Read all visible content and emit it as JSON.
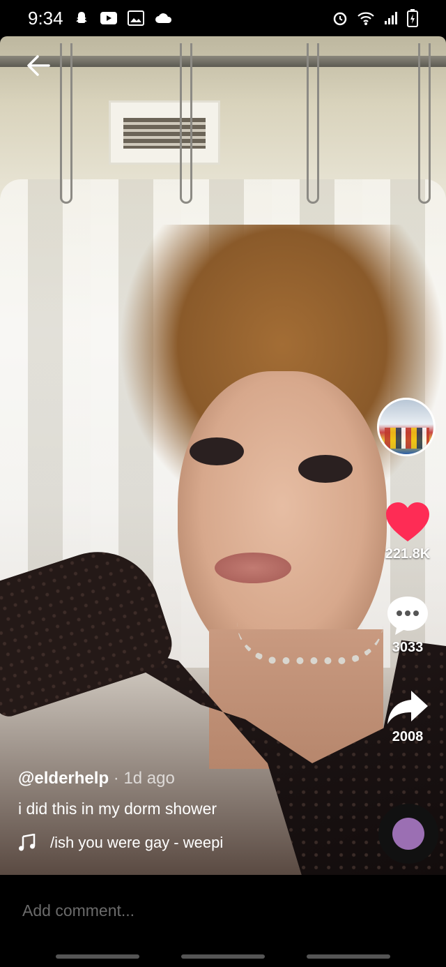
{
  "status_bar": {
    "time": "9:34",
    "left_icons": [
      "snapchat-icon",
      "youtube-icon",
      "gallery-icon",
      "cloud-icon"
    ],
    "right_icons": [
      "alarm-icon",
      "wifi-icon",
      "signal-icon",
      "battery-charging-icon"
    ]
  },
  "video": {
    "back_icon": "arrow-left-icon"
  },
  "actions": {
    "likes": "221.8K",
    "comments": "3033",
    "shares": "2008",
    "like_color": "#fe2c55"
  },
  "caption": {
    "author": "@elderhelp",
    "age": " · 1d ago",
    "description": "i did this in my dorm shower",
    "music": "/ish you were gay - weepi"
  },
  "comment": {
    "placeholder": "Add comment..."
  }
}
